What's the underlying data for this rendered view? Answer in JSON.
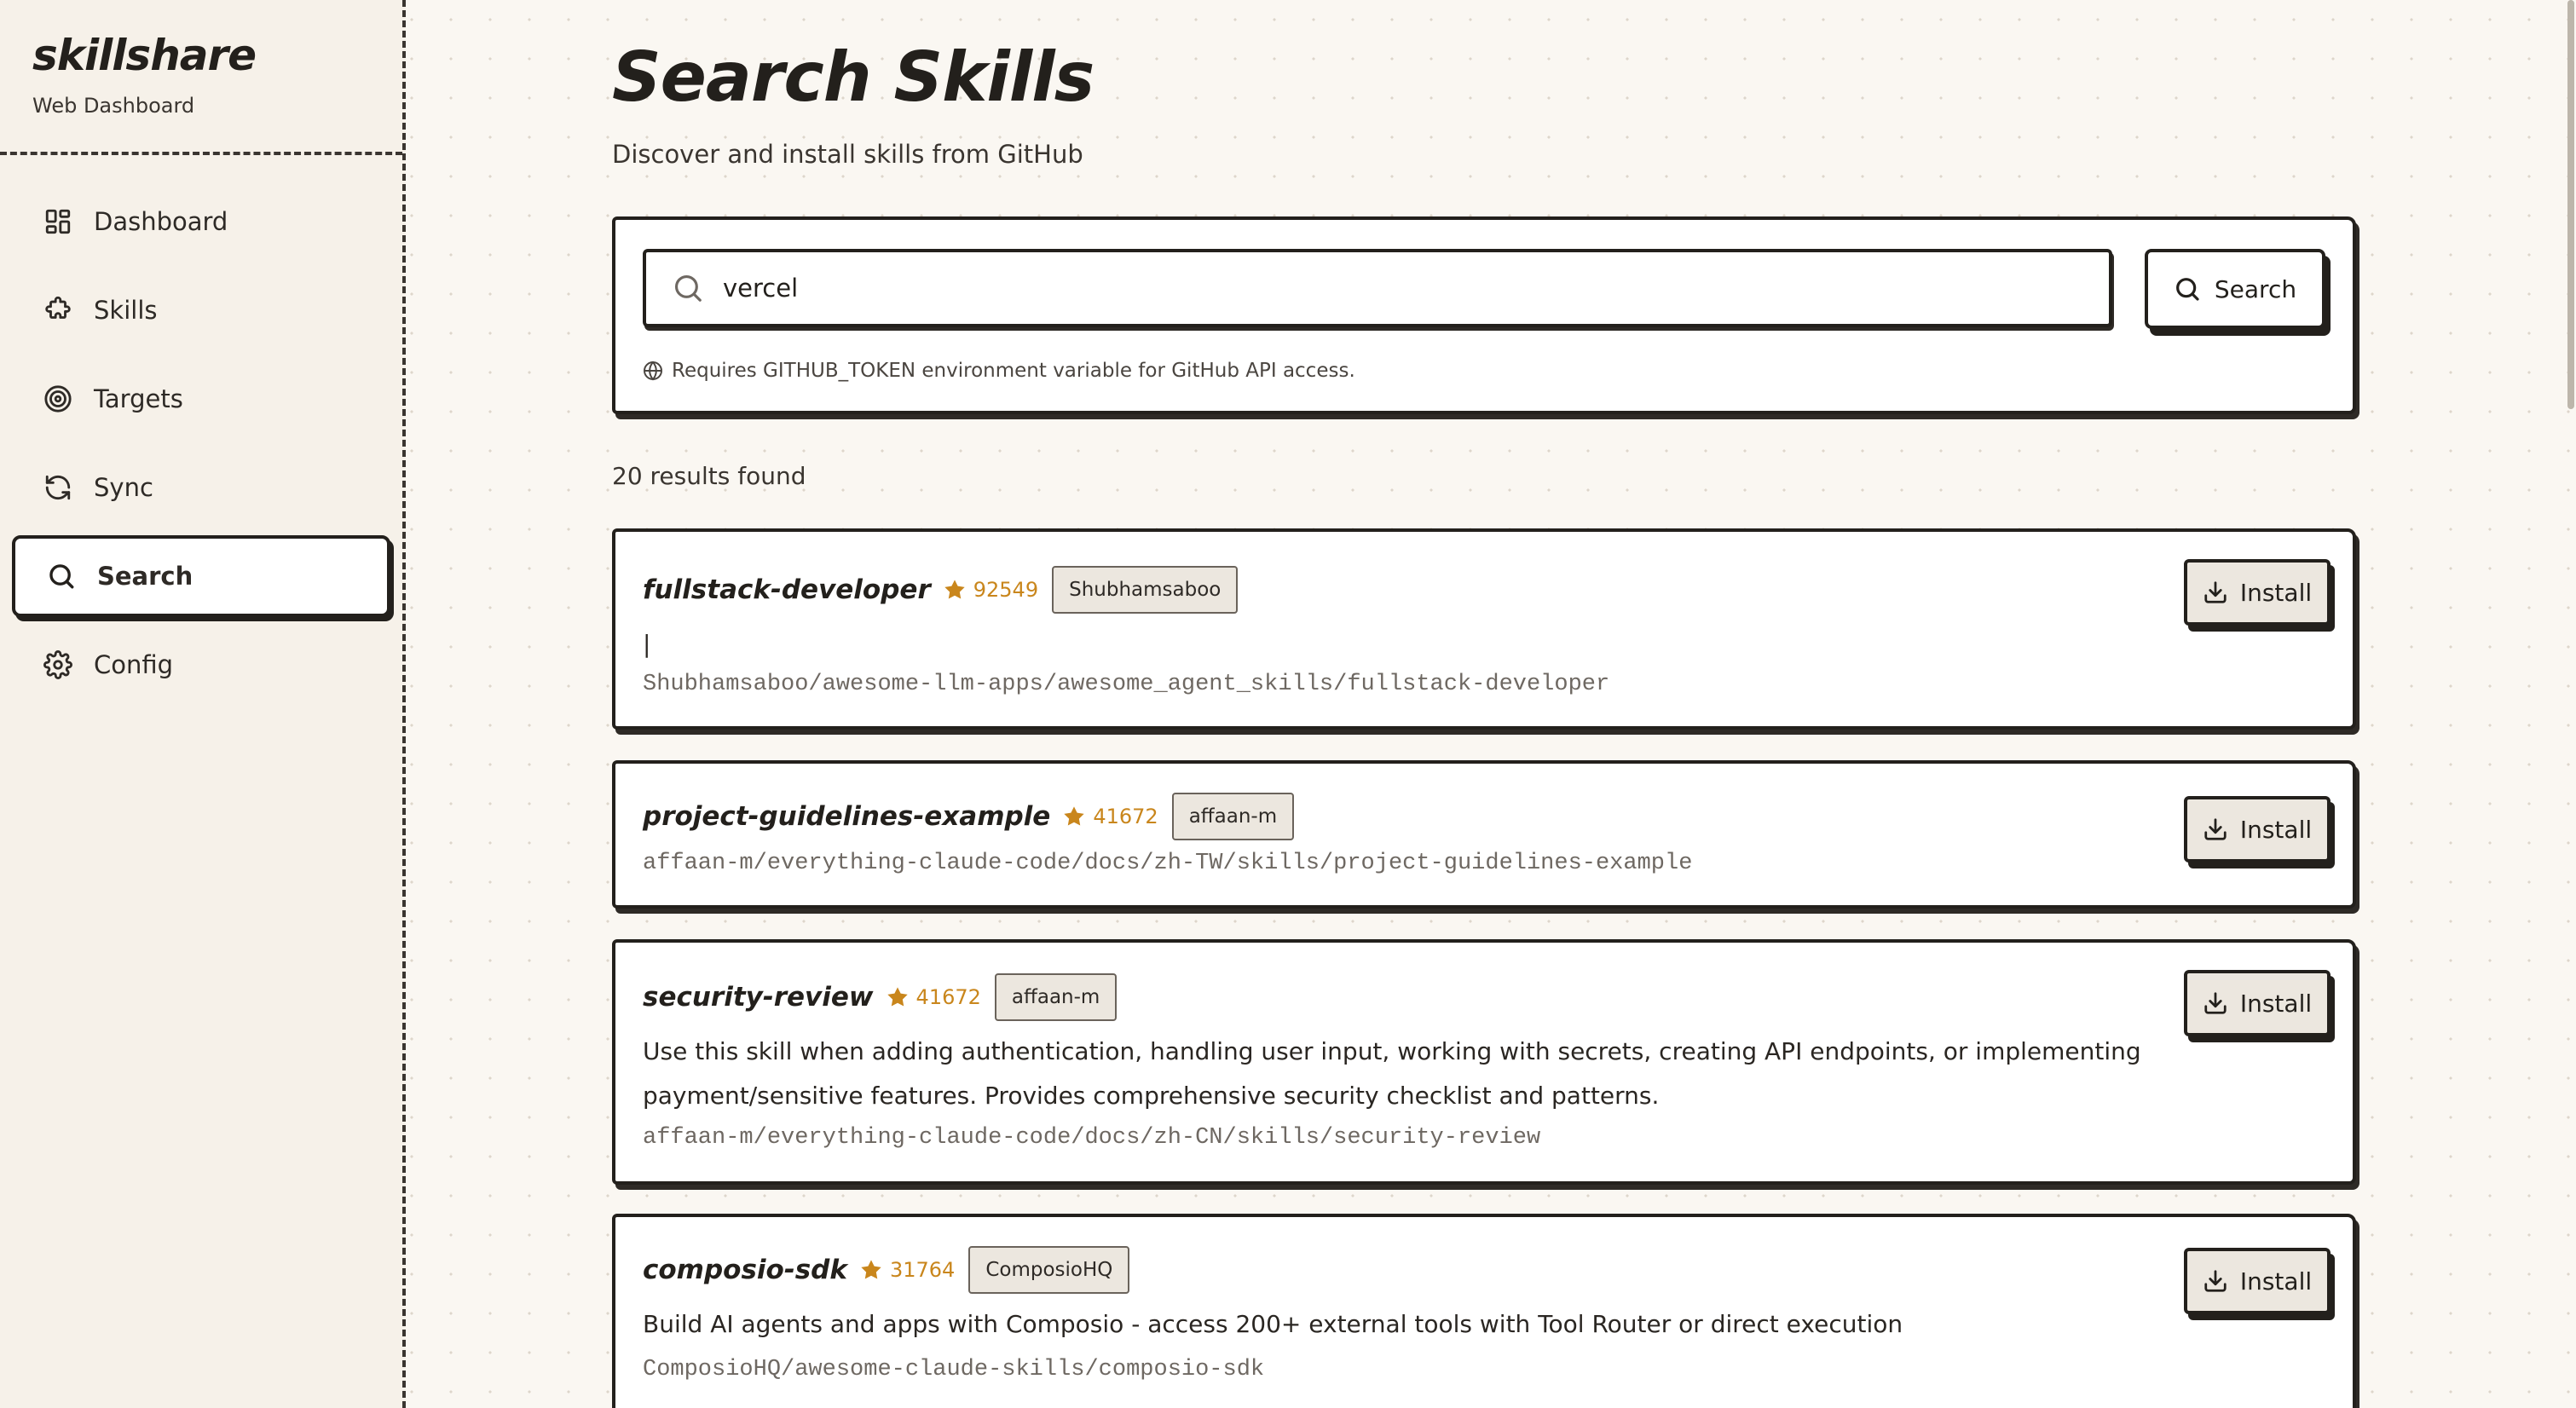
{
  "sidebar": {
    "brand_title": "skillshare",
    "brand_subtitle": "Web Dashboard",
    "items": [
      {
        "label": "Dashboard",
        "icon": "dashboard-icon"
      },
      {
        "label": "Skills",
        "icon": "puzzle-icon"
      },
      {
        "label": "Targets",
        "icon": "target-icon"
      },
      {
        "label": "Sync",
        "icon": "sync-icon"
      },
      {
        "label": "Search",
        "icon": "search-icon",
        "active": true
      },
      {
        "label": "Config",
        "icon": "gear-icon"
      }
    ]
  },
  "page": {
    "title": "Search Skills",
    "subtitle": "Discover and install skills from GitHub"
  },
  "search": {
    "value": "vercel",
    "button_label": "Search",
    "hint": "Requires GITHUB_TOKEN environment variable for GitHub API access."
  },
  "results": {
    "count_label": "20 results found",
    "install_label": "Install",
    "items": [
      {
        "name": "fullstack-developer",
        "stars": "92549",
        "owner": "Shubhamsaboo",
        "description": "|",
        "path": "Shubhamsaboo/awesome-llm-apps/awesome_agent_skills/fullstack-developer"
      },
      {
        "name": "project-guidelines-example",
        "stars": "41672",
        "owner": "affaan-m",
        "description": "",
        "path": "affaan-m/everything-claude-code/docs/zh-TW/skills/project-guidelines-example"
      },
      {
        "name": "security-review",
        "stars": "41672",
        "owner": "affaan-m",
        "description": "Use this skill when adding authentication, handling user input, working with secrets, creating API endpoints, or implementing payment/sensitive features. Provides comprehensive security checklist and patterns.",
        "path": "affaan-m/everything-claude-code/docs/zh-CN/skills/security-review"
      },
      {
        "name": "composio-sdk",
        "stars": "31764",
        "owner": "ComposioHQ",
        "description": "Build AI agents and apps with Composio - access 200+ external tools with Tool Router or direct execution",
        "path": "ComposioHQ/awesome-claude-skills/composio-sdk"
      }
    ]
  },
  "colors": {
    "accent_star": "#c9861c",
    "ink": "#23201c",
    "paper": "#faf7f2"
  }
}
